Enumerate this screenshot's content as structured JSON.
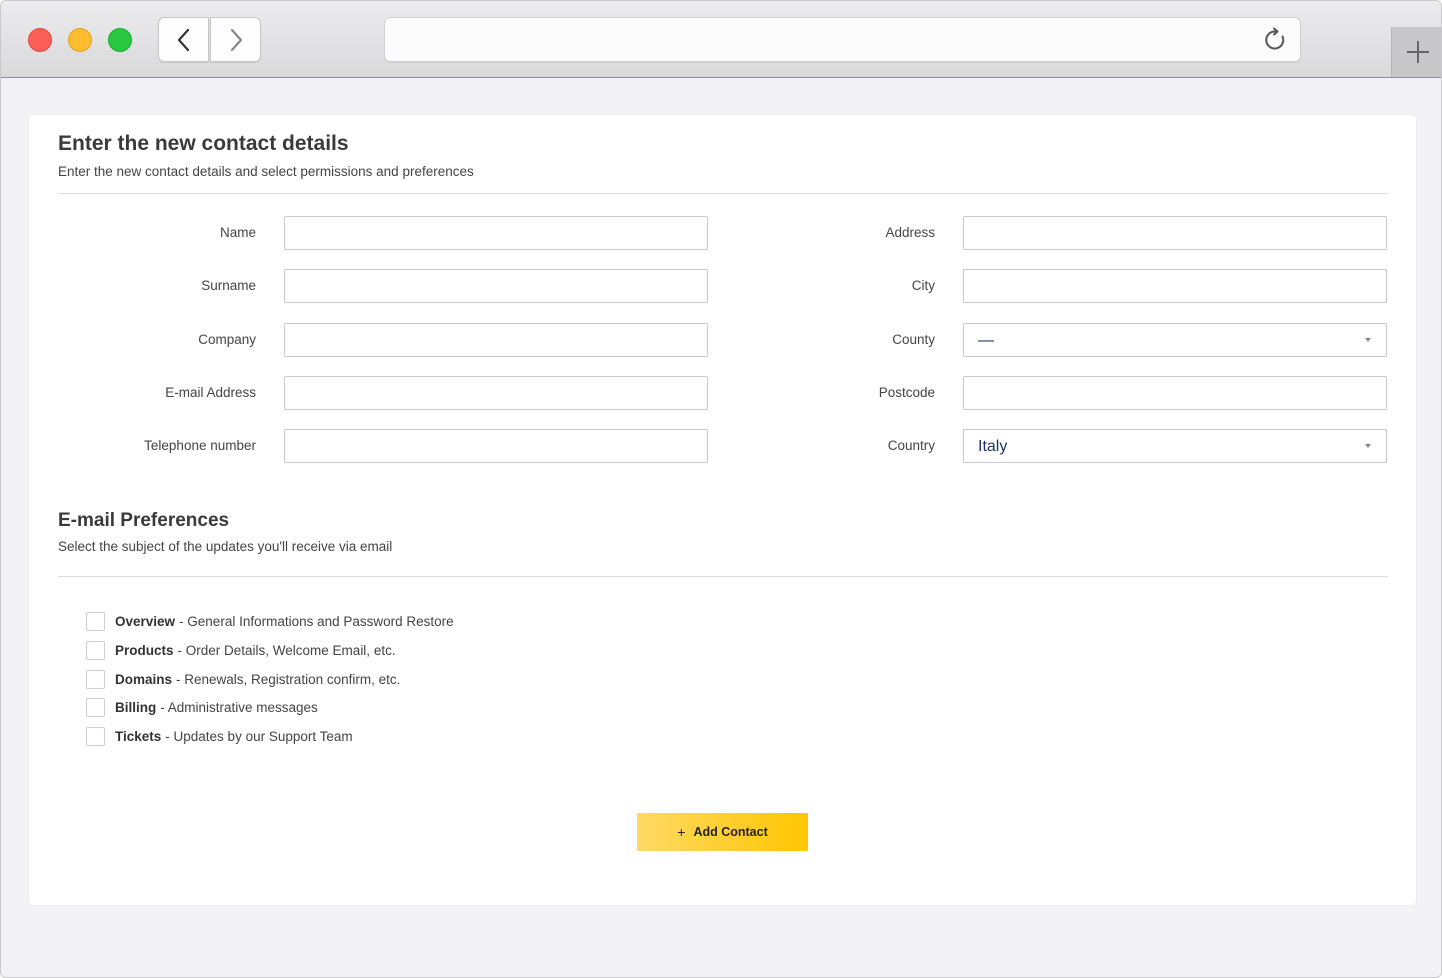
{
  "form": {
    "title": "Enter the new contact details",
    "subtitle": "Enter the new contact details and select permissions and preferences",
    "left_fields": [
      {
        "label": "Name",
        "value": ""
      },
      {
        "label": "Surname",
        "value": ""
      },
      {
        "label": "Company",
        "value": ""
      },
      {
        "label": "E-mail Address",
        "value": ""
      },
      {
        "label": "Telephone number",
        "value": ""
      }
    ],
    "right_fields": {
      "address": {
        "label": "Address",
        "value": ""
      },
      "city": {
        "label": "City",
        "value": ""
      },
      "county": {
        "label": "County",
        "selected": "—"
      },
      "postcode": {
        "label": "Postcode",
        "value": ""
      },
      "country": {
        "label": "Country",
        "selected": "Italy"
      }
    }
  },
  "preferences": {
    "title": "E-mail Preferences",
    "subtitle": "Select the subject of the updates you'll receive via email",
    "items": [
      {
        "name": "Overview",
        "desc": "- General Informations and Password Restore",
        "checked": false
      },
      {
        "name": "Products",
        "desc": "- Order Details, Welcome Email, etc.",
        "checked": false
      },
      {
        "name": "Domains",
        "desc": "- Renewals, Registration confirm, etc.",
        "checked": false
      },
      {
        "name": "Billing",
        "desc": "- Administrative messages",
        "checked": false
      },
      {
        "name": "Tickets",
        "desc": "- Updates by our Support Team",
        "checked": false
      }
    ]
  },
  "actions": {
    "add_label": "Add Contact",
    "add_icon": "+"
  },
  "colors": {
    "accent": "#ffc600",
    "select_text": "#1f3166"
  }
}
